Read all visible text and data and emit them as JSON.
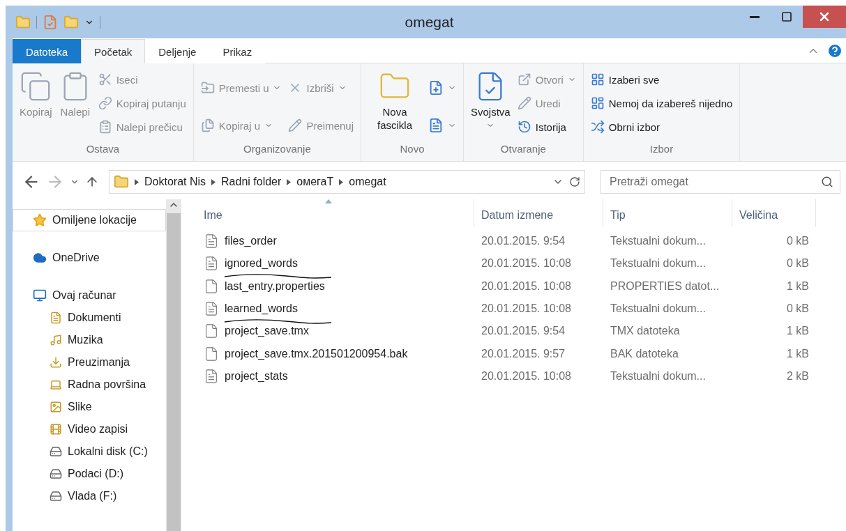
{
  "window": {
    "title": "omegat"
  },
  "ribbon_tabs": [
    {
      "label": "Datoteka",
      "kind": "file",
      "selected": false
    },
    {
      "label": "Početak",
      "kind": "tab",
      "selected": true
    },
    {
      "label": "Deljenje",
      "kind": "tab",
      "selected": false
    },
    {
      "label": "Prikaz",
      "kind": "tab",
      "selected": false
    }
  ],
  "ribbon_groups": [
    {
      "label": "Ostava",
      "columns": [
        [
          {
            "label": "Kopiraj",
            "kind": "large",
            "disabled": true,
            "dropdown": false
          }
        ],
        [
          {
            "label": "Nalepi",
            "kind": "large",
            "disabled": true,
            "dropdown": false
          }
        ],
        [
          {
            "label": "Iseci",
            "kind": "small",
            "disabled": true,
            "dropdown": false
          },
          {
            "label": "Kopiraj putanju",
            "kind": "small",
            "disabled": true,
            "dropdown": false
          },
          {
            "label": "Nalepi prečicu",
            "kind": "small",
            "disabled": true,
            "dropdown": false
          }
        ]
      ]
    },
    {
      "label": "Organizovanje",
      "columns": [
        [
          {
            "label": "Premesti u",
            "kind": "small",
            "disabled": true,
            "dropdown": true
          },
          {
            "label": "Kopiraj u",
            "kind": "small",
            "disabled": true,
            "dropdown": true
          }
        ],
        [
          {
            "label": "Izbriši",
            "kind": "small",
            "disabled": true,
            "dropdown": true
          },
          {
            "label": "Preimenuj",
            "kind": "small",
            "disabled": true,
            "dropdown": false
          }
        ]
      ]
    },
    {
      "label": "Novo",
      "columns": [
        [
          {
            "label": "Nova fascikla",
            "kind": "large",
            "disabled": false,
            "dropdown": false
          }
        ],
        [
          {
            "kind": "icon",
            "disabled": false,
            "dropdown": true
          },
          {
            "kind": "icon",
            "disabled": false,
            "dropdown": true
          }
        ]
      ]
    },
    {
      "label": "Otvaranje",
      "columns": [
        [
          {
            "label": "Svojstva",
            "kind": "large",
            "disabled": false,
            "dropdown": true
          }
        ],
        [
          {
            "label": "Otvori",
            "kind": "small",
            "disabled": true,
            "dropdown": true
          },
          {
            "label": "Uredi",
            "kind": "small",
            "disabled": true,
            "dropdown": false
          },
          {
            "label": "Istorija",
            "kind": "small",
            "disabled": false,
            "dropdown": false
          }
        ]
      ]
    },
    {
      "label": "Izbor",
      "columns": [
        [
          {
            "label": "Izaberi sve",
            "kind": "small",
            "disabled": false,
            "dropdown": false
          },
          {
            "label": "Nemoj da izabereš nijedno",
            "kind": "small",
            "disabled": false,
            "dropdown": false
          },
          {
            "label": "Obrni izbor",
            "kind": "small",
            "disabled": false,
            "dropdown": false
          }
        ]
      ]
    }
  ],
  "address_bar": {
    "breadcrumbs": [
      "Doktorat Nis",
      "Radni folder",
      "омегаТ",
      "omegat"
    ]
  },
  "search": {
    "placeholder": "Pretraži omegat"
  },
  "sidebar": {
    "items": [
      {
        "label": "Omiljene lokacije",
        "selected": true
      },
      {
        "label": "OneDrive",
        "selected": false
      },
      {
        "label": "Ovaj računar",
        "selected": false,
        "children": [
          {
            "label": "Dokumenti",
            "selected": false
          },
          {
            "label": "Muzika",
            "selected": false
          },
          {
            "label": "Preuzimanja",
            "selected": false
          },
          {
            "label": "Radna površina",
            "selected": false
          },
          {
            "label": "Slike",
            "selected": false
          },
          {
            "label": "Video zapisi",
            "selected": false
          },
          {
            "label": "Lokalni disk (C:)",
            "selected": false
          },
          {
            "label": "Podaci (D:)",
            "selected": false
          },
          {
            "label": "Vlada (F:)",
            "selected": false
          }
        ]
      }
    ]
  },
  "table": {
    "columns": [
      {
        "label": "Ime",
        "sorted": true
      },
      {
        "label": "Datum izmene",
        "sorted": false
      },
      {
        "label": "Tip",
        "sorted": false
      },
      {
        "label": "Veličina",
        "sorted": false
      }
    ],
    "rows": [
      {
        "name": "files_order",
        "date": "20.01.2015. 9:54",
        "type": "Tekstualni dokum...",
        "size": "0 kB",
        "kind": "text",
        "underlined": false
      },
      {
        "name": "ignored_words",
        "date": "20.01.2015. 10:08",
        "type": "Tekstualni dokum...",
        "size": "0 kB",
        "kind": "text",
        "underlined": true
      },
      {
        "name": "last_entry.properties",
        "date": "20.01.2015. 10:08",
        "type": "PROPERTIES datot...",
        "size": "1 kB",
        "kind": "plain",
        "underlined": false
      },
      {
        "name": "learned_words",
        "date": "20.01.2015. 10:08",
        "type": "Tekstualni dokum...",
        "size": "0 kB",
        "kind": "text",
        "underlined": true
      },
      {
        "name": "project_save.tmx",
        "date": "20.01.2015. 9:54",
        "type": "TMX datoteka",
        "size": "1 kB",
        "kind": "plain",
        "underlined": false
      },
      {
        "name": "project_save.tmx.201501200954.bak",
        "date": "20.01.2015. 9:57",
        "type": "BAK datoteka",
        "size": "1 kB",
        "kind": "plain",
        "underlined": false
      },
      {
        "name": "project_stats",
        "date": "20.01.2015. 10:08",
        "type": "Tekstualni dokum...",
        "size": "2 kB",
        "kind": "text",
        "underlined": false
      }
    ]
  }
}
